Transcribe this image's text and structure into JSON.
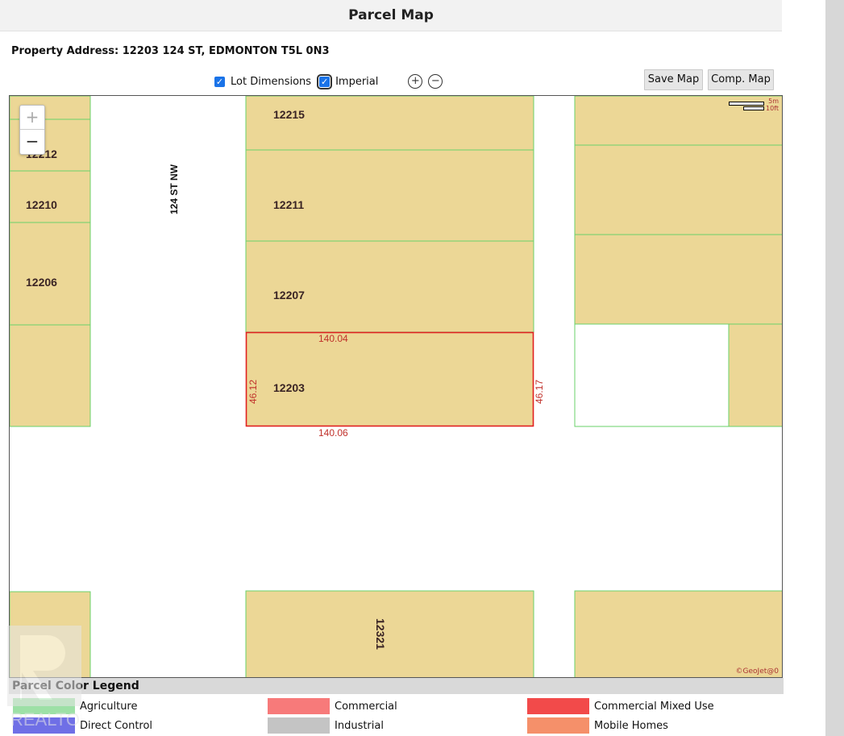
{
  "header": {
    "title": "Parcel Map"
  },
  "property": {
    "address": "Property Address: 12203 124 ST, EDMONTON T5L 0N3"
  },
  "options": {
    "lot_dimensions_label": "Lot Dimensions",
    "imperial_label": "Imperial"
  },
  "buttons": {
    "save_map": "Save Map",
    "comp_map": "Comp. Map"
  },
  "map": {
    "zoom_in": "+",
    "zoom_out": "−",
    "street_label": "124 ST NW",
    "scale_metric": "5m",
    "scale_imperial": "10ft",
    "attribution": "©GeoJet@0",
    "parcel_labels": {
      "p12215": "12215",
      "p12212": "12212",
      "p12211": "12211",
      "p12210": "12210",
      "p12207": "12207",
      "p12206": "12206",
      "p12203": "12203",
      "p12321": "12321"
    },
    "dimensions": {
      "top": "140.04",
      "bottom": "140.06",
      "left": "46.12",
      "right": "46.17"
    },
    "colors": {
      "parcel_fill": "#ecd796",
      "parcel_border": "#6ad26a",
      "selected_border": "#e02020",
      "dimension_text": "#c0302a"
    }
  },
  "legend": {
    "title": "Parcel Color Legend",
    "items": [
      {
        "label": "Agriculture",
        "color": "#9de0a6"
      },
      {
        "label": "Commercial",
        "color": "#f77a7a"
      },
      {
        "label": "Commercial Mixed Use",
        "color": "#f24a4a"
      },
      {
        "label": "Direct Control",
        "color": "#6f6fe6"
      },
      {
        "label": "Industrial",
        "color": "#c4c4c4"
      },
      {
        "label": "Mobile Homes",
        "color": "#f5906a"
      }
    ]
  },
  "watermark": {
    "text": "REALTOR"
  }
}
